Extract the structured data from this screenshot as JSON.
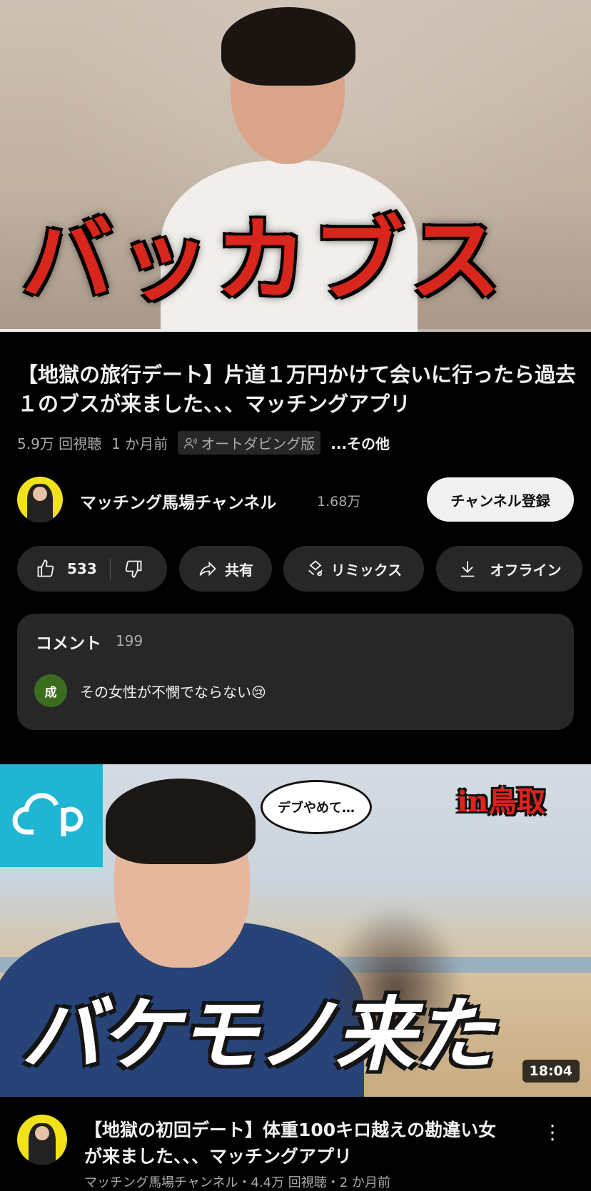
{
  "player": {
    "overlay_text": "バッカブス",
    "progress_fraction": 0.34
  },
  "video": {
    "title": "【地獄の旅行デート】片道１万円かけて会いに行ったら過去１のブスが来ました、、、マッチングアプリ",
    "views": "5.9万 回視聴",
    "age": "1 か月前",
    "dub_label": "オートダビング版",
    "more_label": "...その他"
  },
  "channel": {
    "name": "マッチング馬場チャンネル",
    "subscribers": "1.68万",
    "subscribe_label": "チャンネル登録"
  },
  "actions": {
    "like_count": "533",
    "share_label": "共有",
    "remix_label": "リミックス",
    "offline_label": "オフライン"
  },
  "comments": {
    "header": "コメント",
    "count": "199",
    "top_comment": {
      "avatar_initial": "成",
      "text": "その女性が不憫でならない😢"
    }
  },
  "next_video": {
    "thumb_speech": "デブやめて…",
    "thumb_tag": "in鳥取",
    "thumb_text": "バケモノ来た",
    "duration": "18:04",
    "title": "【地獄の初回デート】体重100キロ越えの勘違い女が来ました、、、マッチングアプリ",
    "meta": "マッチング馬場チャンネル・4.4万 回視聴・2 か月前"
  },
  "icons": {
    "like": "thumbs-up-icon",
    "dislike": "thumbs-down-icon",
    "share": "share-arrow-icon",
    "remix": "remix-icon",
    "offline": "download-icon",
    "dub": "person-voice-icon",
    "more": "kebab-menu-icon"
  },
  "colors": {
    "background": "#000000",
    "pill": "#272727",
    "subscribe_bg": "#f1f1f1",
    "secondary_text": "#aaaaaa",
    "overlay_red": "#d9261c",
    "logo_cyan": "#20b5d3"
  }
}
